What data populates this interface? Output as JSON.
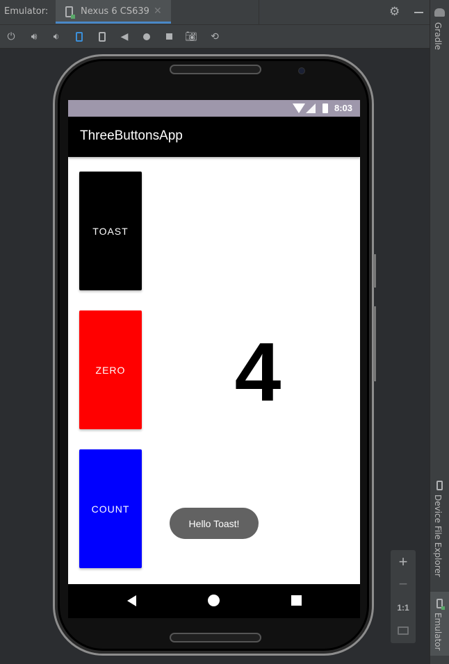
{
  "topbar": {
    "label": "Emulator:",
    "tab_title": "Nexus 6 CS639",
    "tab_close": "✕",
    "settings_icon": "gear-icon",
    "minimize_icon": "minimize-icon"
  },
  "toolbar": {
    "icons": [
      "power-icon",
      "volume-up-icon",
      "volume-down-icon",
      "rotate-left-icon",
      "rotate-right-icon",
      "back-icon",
      "home-icon",
      "overview-icon",
      "screenshot-icon",
      "zoom-icon"
    ]
  },
  "side": {
    "gradle": "Gradle",
    "device_file_explorer": "Device File Explorer",
    "emulator": "Emulator"
  },
  "device": {
    "status": {
      "time": "8:03"
    },
    "app_title": "ThreeButtonsApp",
    "buttons": {
      "toast": "TOAST",
      "zero": "ZERO",
      "count": "COUNT"
    },
    "count_value": "4",
    "toast_message": "Hello Toast!"
  },
  "zoom": {
    "zoom_in": "+",
    "zoom_out": "−",
    "actual_size": "1:1"
  },
  "colors": {
    "toast_button": "#000000",
    "zero_button": "#ff0000",
    "count_button": "#0000ff",
    "status_bar": "#9e97ab",
    "tab_accent": "#4a88c7"
  }
}
